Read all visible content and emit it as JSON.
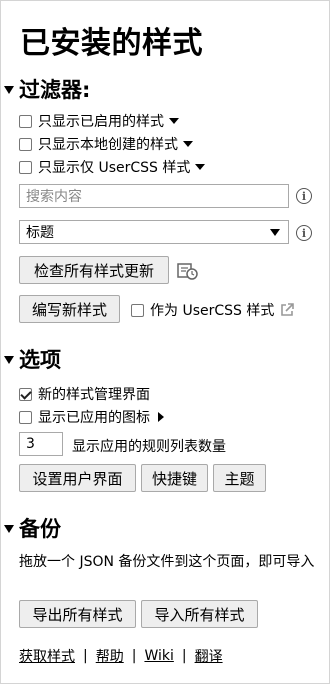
{
  "page_title": "已安装的样式",
  "filters": {
    "heading": "过滤器:",
    "options": [
      {
        "label": "只显示已启用的样式",
        "checked": false
      },
      {
        "label": "只显示本地创建的样式",
        "checked": false
      },
      {
        "label": "只显示仅 UserCSS 样式",
        "checked": false
      }
    ],
    "search_placeholder": "搜索内容",
    "sort_select": "标题"
  },
  "actions": {
    "check_updates": "检查所有样式更新",
    "write_new": "编写新样式",
    "as_usercss": "作为 UserCSS 样式"
  },
  "options": {
    "heading": "选项",
    "new_ui": {
      "label": "新的样式管理界面",
      "checked": true
    },
    "show_icons": {
      "label": "显示已应用的图标",
      "checked": false
    },
    "rules_count": {
      "value": "3",
      "label": "显示应用的规则列表数量"
    },
    "buttons": [
      "设置用户界面",
      "快捷键",
      "主题"
    ]
  },
  "backup": {
    "heading": "备份",
    "description": "拖放一个 JSON 备份文件到这个页面，即可导入",
    "export": "导出所有样式",
    "import": "导入所有样式"
  },
  "footer_links": [
    "获取样式",
    "帮助",
    "Wiki",
    "翻译"
  ]
}
